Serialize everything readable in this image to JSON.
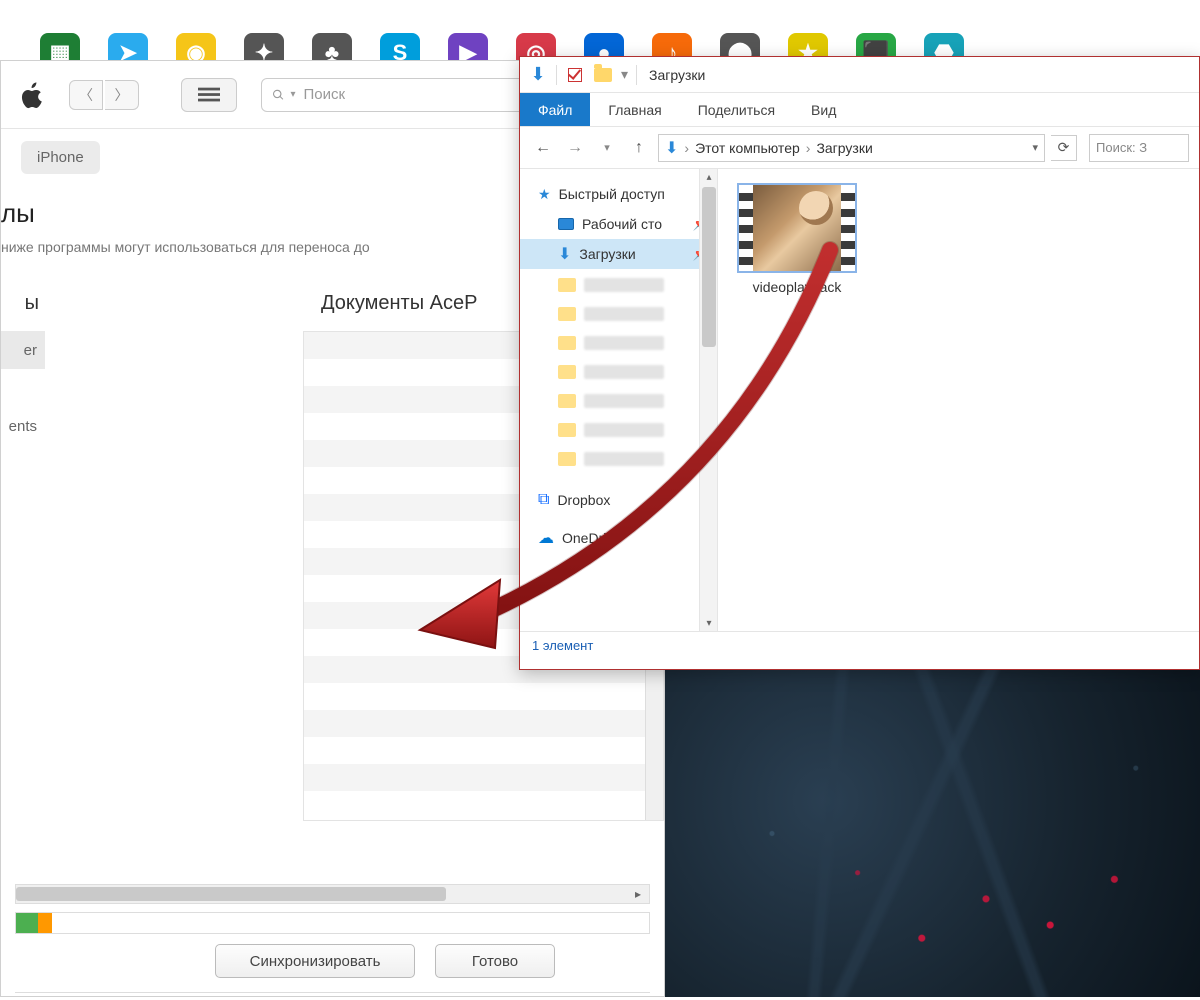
{
  "itunes": {
    "search_placeholder": "Поиск",
    "device_label": "iPhone",
    "section_title_suffix": "лы",
    "section_desc": "ниже программы могут использоваться для переноса до",
    "left_header_suffix": "ы",
    "left_items": [
      "er",
      "",
      "ents",
      "",
      ""
    ],
    "right_header": "Документы AceP",
    "sync_label": "Синхронизировать",
    "done_label": "Готово"
  },
  "explorer": {
    "title": "Загрузки",
    "tabs": {
      "file": "Файл",
      "home": "Главная",
      "share": "Поделиться",
      "view": "Вид"
    },
    "breadcrumb": {
      "root": "Этот компьютер",
      "leaf": "Загрузки"
    },
    "search_placeholder": "Поиск: З",
    "sidebar": {
      "quick": "Быстрый доступ",
      "desktop": "Рабочий сто",
      "downloads": "Загрузки",
      "dropbox": "Dropbox",
      "onedrive": "OneDrive"
    },
    "file_name": "videoplayback",
    "status": "1 элемент"
  },
  "colors": {
    "explorer_border": "#b03030",
    "accent_blue": "#1979ca",
    "arrow_red": "#b21e1e"
  }
}
